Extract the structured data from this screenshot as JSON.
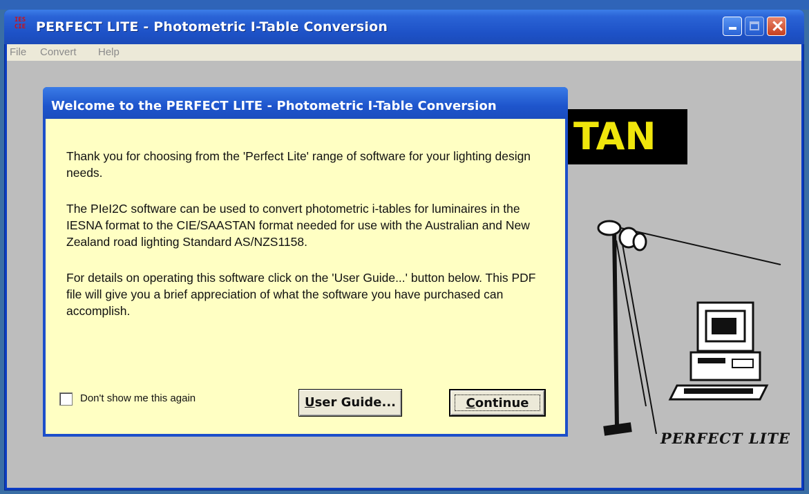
{
  "window": {
    "title": "PERFECT LITE - Photometric I-Table Conversion",
    "icon_top": "IES",
    "icon_bottom": "CIE"
  },
  "menu": [
    "File",
    "Convert",
    "Help"
  ],
  "splash": {
    "logo_text": "TAN",
    "brand_text": "PERFECT LITE"
  },
  "dialog": {
    "title": "Welcome to the PERFECT LITE - Photometric I-Table Conversion",
    "paragraphs": [
      "Thank you for choosing from the 'Perfect Lite' range of software for your lighting design needs.",
      "The PIeI2C software can be used to convert photometric i-tables for luminaires in the IESNA format to the CIE/SAASTAN format needed for use with the Australian and New Zealand road lighting Standard AS/NZS1158.",
      "For details on operating this software click on the 'User Guide...' button below.  This PDF file will give you a brief appreciation of what the software you have purchased can accomplish."
    ],
    "checkbox_label": "Don't show me this again",
    "checkbox_checked": false,
    "user_guide_button": "User Guide...",
    "continue_button": "Continue"
  },
  "colors": {
    "titlebar": "#1d51c6",
    "dialog_body": "#ffffc3",
    "client_bg": "#bdbdbd",
    "logo_yellow": "#f0e60c"
  }
}
